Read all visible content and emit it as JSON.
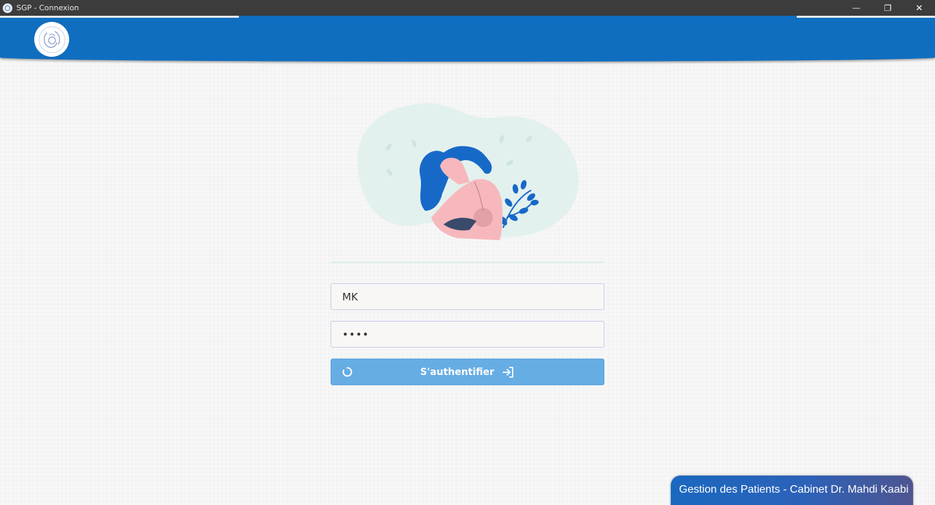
{
  "window": {
    "title": "SGP - Connexion",
    "minimize_glyph": "—",
    "maximize_glyph": "❐",
    "close_glyph": "✕"
  },
  "login": {
    "username_value": "MK",
    "password_value": "1234",
    "submit_label": "S'authentifier"
  },
  "footer": {
    "text": "Gestion des Patients - Cabinet Dr. Mahdi Kaabi"
  },
  "colors": {
    "header": "#0f6ec0",
    "button": "#66ade4",
    "titlebar": "#3c3c3c"
  },
  "icons": {
    "app": "mother-child-logo-icon",
    "spinner": "spinner-icon",
    "login": "sign-in-icon"
  }
}
